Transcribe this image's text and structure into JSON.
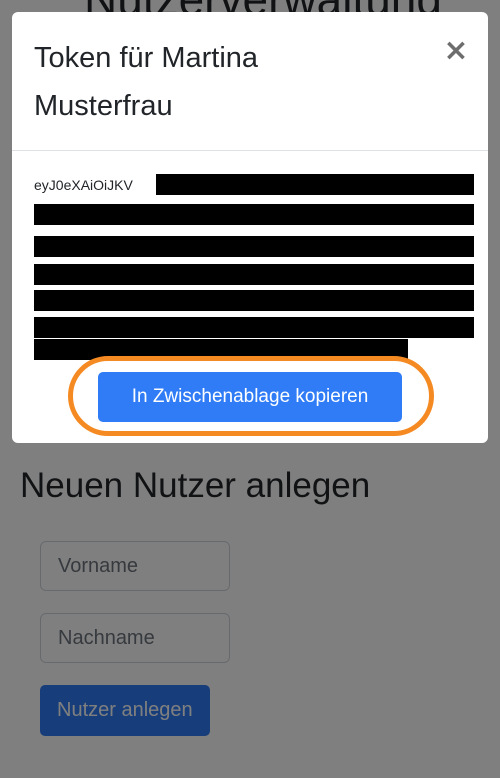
{
  "page": {
    "title": "Nutzerverwaltung",
    "new_user_section_title": "Neuen Nutzer anlegen",
    "first_name_placeholder": "Vorname",
    "last_name_placeholder": "Nachname",
    "create_user_label": "Nutzer anlegen"
  },
  "modal": {
    "title": "Token für Martina Musterfrau",
    "close_label": "×",
    "token_visible_text": "eyJ0eXAiOiJKV",
    "token_redacted": true,
    "copy_button_label": "In Zwischenablage kopieren",
    "highlight_color": "#f58a22"
  },
  "colors": {
    "primary": "#2f7cf6",
    "backdrop": "rgba(0,0,0,0.5)"
  }
}
